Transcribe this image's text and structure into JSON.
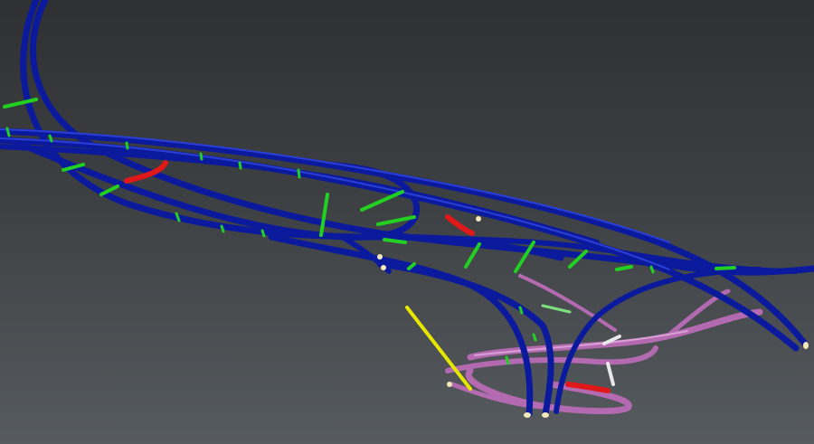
{
  "viewport": {
    "background_top": "#2f3032",
    "background_bottom": "#565b5f"
  },
  "legend_colors": {
    "main_drive": "#0b1a9c",
    "main_drive_highlight": "#2a3fd8",
    "crosscut": "#22d022",
    "crosscut_alt": "#7ee07e",
    "ventilation_red": "#e01818",
    "decline_pink": "#b36ab0",
    "decline_pink_highlight": "#d9a0d6",
    "shaft_yellow": "#e6e600",
    "connector_white": "#e8e8e8",
    "tube_end_cap": "#f2e8b8"
  }
}
